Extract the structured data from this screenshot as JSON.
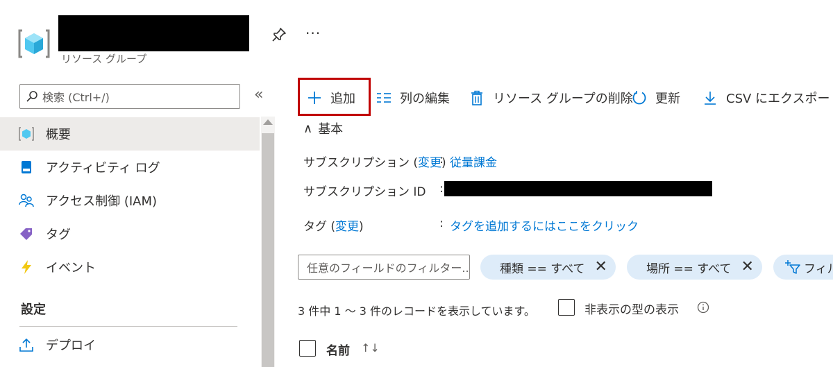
{
  "header": {
    "subtitle": "リソース グループ",
    "more_label": "···",
    "icons": {
      "resource_group": "resource-group-cube-icon",
      "pin": "pin-icon"
    }
  },
  "sidebar": {
    "search_placeholder": "検索 (Ctrl+/)",
    "collapse_label": "«",
    "items": [
      {
        "label": "概要",
        "icon": "overview-cube-icon",
        "active": true
      },
      {
        "label": "アクティビティ ログ",
        "icon": "activity-log-icon"
      },
      {
        "label": "アクセス制御 (IAM)",
        "icon": "people-icon"
      },
      {
        "label": "タグ",
        "icon": "tag-icon"
      },
      {
        "label": "イベント",
        "icon": "lightning-icon"
      }
    ],
    "section_settings": "設定",
    "settings_items": [
      {
        "label": "デプロイ",
        "icon": "deploy-upload-icon"
      }
    ]
  },
  "toolbar": {
    "add": "追加",
    "edit_columns": "列の編集",
    "delete_rg": "リソース グループの削除",
    "refresh": "更新",
    "export_csv": "CSV にエクスポート"
  },
  "essentials": {
    "heading": "基本",
    "chevron": "∧",
    "subscription_label": "サブスクリプション",
    "change_link": "変更",
    "subscription_value": "従量課金",
    "subscription_id_label": "サブスクリプション ID",
    "tags_label": "タグ",
    "tags_value": "タグを追加するにはここをクリック",
    "colon": ":"
  },
  "filters": {
    "input_placeholder": "任意のフィールドのフィルター...",
    "pill_type": "種類 == すべて",
    "pill_location": "場所 == すべて",
    "add_filter": "フィル",
    "close_glyph": "✕"
  },
  "records": {
    "summary": "3 件中 1 ～ 3 件のレコードを表示しています。",
    "show_hidden_types": "非表示の型の表示",
    "column_name": "名前",
    "sort_glyph": "↑↓"
  },
  "colors": {
    "accent": "#0078d4",
    "highlight": "#c00000",
    "pill": "#deecf9",
    "active_nav": "#edebe9"
  }
}
